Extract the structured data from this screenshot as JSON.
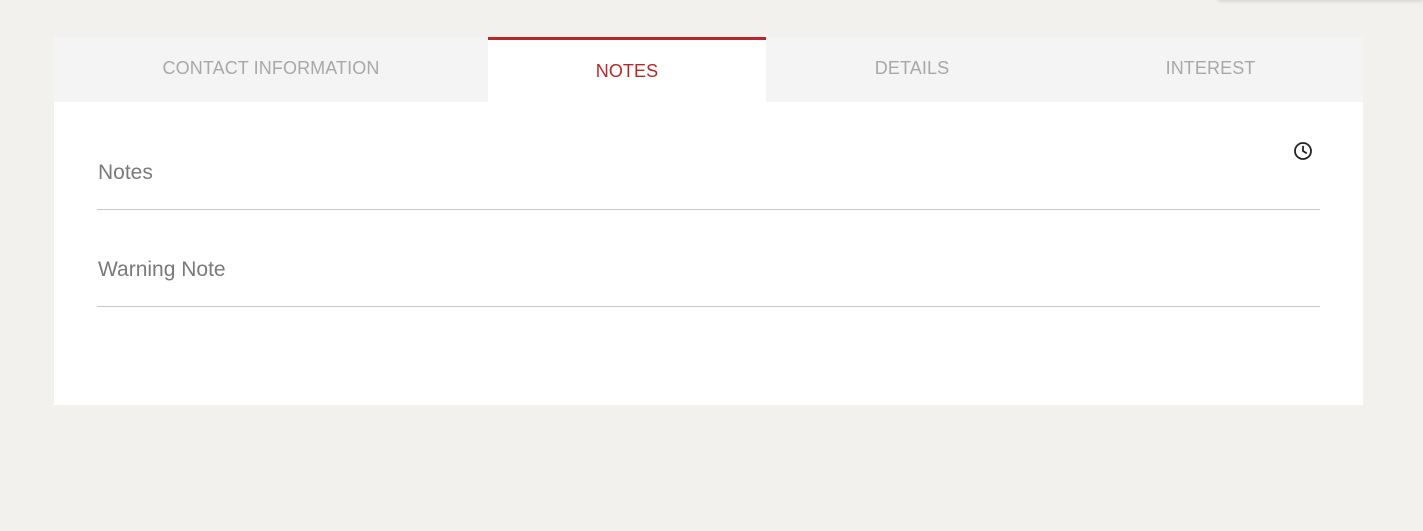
{
  "tabs": [
    {
      "label": "CONTACT INFORMATION",
      "active": false
    },
    {
      "label": "NOTES",
      "active": true
    },
    {
      "label": "DETAILS",
      "active": false
    },
    {
      "label": "INTEREST",
      "active": false
    }
  ],
  "fields": {
    "notes": {
      "label": "Notes",
      "value": ""
    },
    "warning_note": {
      "label": "Warning Note",
      "value": ""
    }
  },
  "icons": {
    "history": "clock-icon"
  },
  "colors": {
    "accent": "#b7282b",
    "page_background": "#f2f1ee",
    "tab_bar": "#f4f4f4",
    "inactive_tab_text": "#a8a8a8",
    "field_label": "#7a7a7a"
  }
}
